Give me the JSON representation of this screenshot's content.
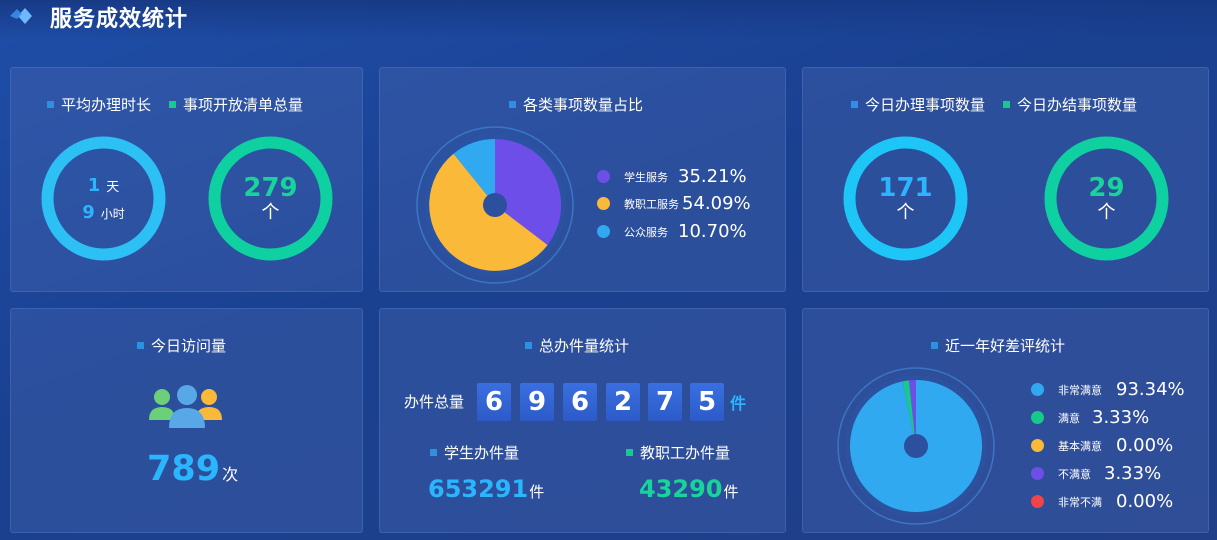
{
  "header": {
    "title": "服务成效统计"
  },
  "panel_duration": {
    "legend_a": "平均办理时长",
    "legend_b": "事项开放清单总量",
    "days_value": "1",
    "days_unit": "天",
    "hours_value": "9",
    "hours_unit": "小时",
    "items_value": "279",
    "items_unit": "个"
  },
  "panel_ratio": {
    "title": "各类事项数量占比",
    "legend": [
      {
        "label": "学生服务",
        "value": "35.21%",
        "color": "#6e4ee8"
      },
      {
        "label": "教职工服务",
        "value": "54.09%",
        "color": "#fbb93a"
      },
      {
        "label": "公众服务",
        "value": "10.70%",
        "color": "#31a9f1"
      }
    ]
  },
  "panel_today": {
    "legend_a": "今日办理事项数量",
    "legend_b": "今日办结事项数量",
    "handled_value": "171",
    "handled_unit": "个",
    "finished_value": "29",
    "finished_unit": "个"
  },
  "panel_visits": {
    "title": "今日访问量",
    "value": "789",
    "unit": "次",
    "icon": "users-icon"
  },
  "panel_total": {
    "title": "总办件量统计",
    "total_label": "办件总量",
    "digits": [
      "6",
      "9",
      "6",
      "2",
      "7",
      "5"
    ],
    "total_unit": "件",
    "student_label": "学生办件量",
    "student_value": "653291",
    "student_unit": "件",
    "staff_label": "教职工办件量",
    "staff_value": "43290",
    "staff_unit": "件"
  },
  "panel_rating": {
    "title": "近一年好差评统计",
    "legend": [
      {
        "label": "非常满意",
        "value": "93.34%",
        "color": "#31a9f1"
      },
      {
        "label": "满意",
        "value": "3.33%",
        "color": "#17c98a"
      },
      {
        "label": "基本满意",
        "value": "0.00%",
        "color": "#fbb93a"
      },
      {
        "label": "不满意",
        "value": "3.33%",
        "color": "#6e4ee8"
      },
      {
        "label": "非常不满",
        "value": "0.00%",
        "color": "#f0434a"
      }
    ]
  },
  "colors": {
    "legend_blue": "#2f8fe0",
    "legend_green": "#17c98a",
    "ring_blue": "#2cc0f5",
    "ring_green": "#0fd0a0",
    "number_blue": "#2cb5ff",
    "number_green": "#17d49a"
  }
}
